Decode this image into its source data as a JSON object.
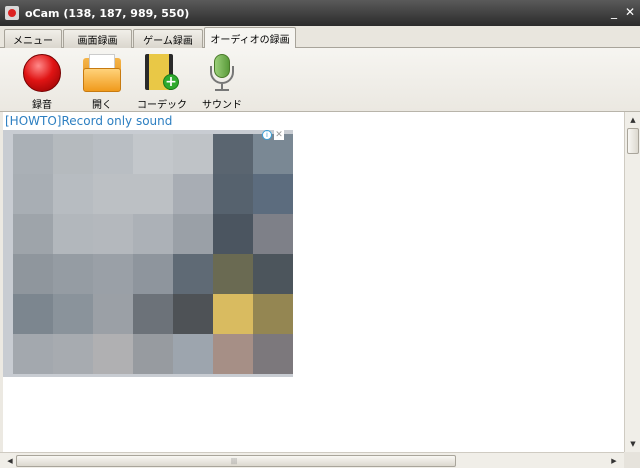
{
  "window": {
    "title": "oCam (138, 187, 989, 550)",
    "minimize_glyph": "_",
    "close_glyph": "✕"
  },
  "tabs": [
    {
      "label": "メニュー",
      "active": false
    },
    {
      "label": "画面録画",
      "active": false
    },
    {
      "label": "ゲーム録画",
      "active": false
    },
    {
      "label": "オーディオの録画",
      "active": true
    }
  ],
  "toolbar": {
    "record_label": "録音",
    "open_label": "開く",
    "codec_label": "コーデック",
    "sound_label": "サウンド"
  },
  "content": {
    "howto_link": "[HOWTO]Record only sound",
    "ad_info_glyph": "i",
    "ad_close_glyph": "✕",
    "ad_pixel_colors": [
      [
        "#aab0b6",
        "#b5babe",
        "#b9bec3",
        "#c3c7cb",
        "#bfc3c7",
        "#5a6570",
        "#7a8894"
      ],
      [
        "#a8aeb4",
        "#b7bcc1",
        "#bcc0c4",
        "#bcc0c4",
        "#a8adb4",
        "#56626e",
        "#5c6c7e"
      ],
      [
        "#9ea4aa",
        "#b2b7bc",
        "#b4b8bd",
        "#acb1b7",
        "#9aa0a7",
        "#4b5560",
        "#7e8088"
      ],
      [
        "#8f969d",
        "#959ca3",
        "#9aa0a7",
        "#8e959d",
        "#5f6a75",
        "#6a6a52",
        "#4c555c"
      ],
      [
        "#7c868f",
        "#8a939b",
        "#9ba0a6",
        "#6c7279",
        "#4e5256",
        "#d9bb60",
        "#948652"
      ],
      [
        "#a3a8ae",
        "#a7abb0",
        "#b0b0b2",
        "#979ba0",
        "#9da5ae",
        "#a68f86",
        "#7c787c"
      ]
    ]
  }
}
